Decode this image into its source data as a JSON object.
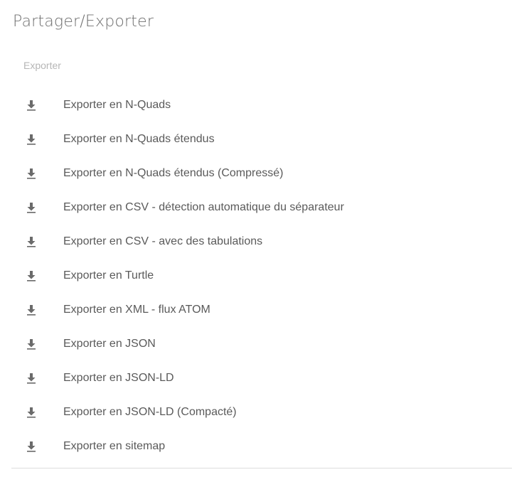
{
  "header": {
    "title": "Partager/Exporter"
  },
  "section": {
    "label": "Exporter"
  },
  "export_items": [
    {
      "label": "Exporter en N-Quads",
      "icon": "download-icon"
    },
    {
      "label": "Exporter en N-Quads étendus",
      "icon": "download-icon"
    },
    {
      "label": "Exporter en N-Quads étendus (Compressé)",
      "icon": "download-icon"
    },
    {
      "label": "Exporter en CSV - détection automatique du séparateur",
      "icon": "download-icon"
    },
    {
      "label": "Exporter en CSV - avec des tabulations",
      "icon": "download-icon"
    },
    {
      "label": "Exporter en Turtle",
      "icon": "download-icon"
    },
    {
      "label": "Exporter en XML - flux ATOM",
      "icon": "download-icon"
    },
    {
      "label": "Exporter en JSON",
      "icon": "download-icon"
    },
    {
      "label": "Exporter en JSON-LD",
      "icon": "download-icon"
    },
    {
      "label": "Exporter en JSON-LD (Compacté)",
      "icon": "download-icon"
    },
    {
      "label": "Exporter en sitemap",
      "icon": "download-icon"
    }
  ],
  "colors": {
    "icon": "#6b6b6b",
    "label": "#5a5a5a",
    "section_label": "#b6b6b6",
    "divider": "#dcdcdc"
  }
}
